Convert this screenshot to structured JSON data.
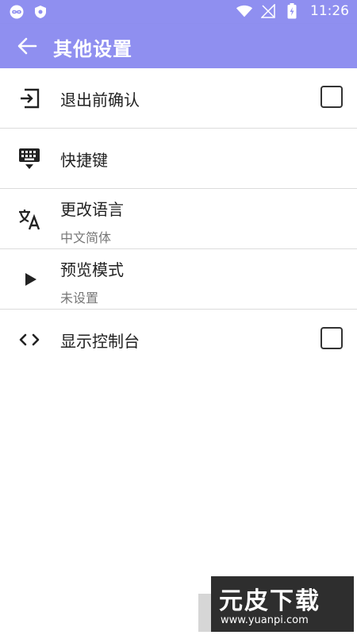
{
  "status_bar": {
    "time": "11:26",
    "icons": [
      "infinity-icon",
      "shield-icon",
      "wifi-icon",
      "signal-icon",
      "battery-charging-icon"
    ]
  },
  "app_bar": {
    "title": "其他设置"
  },
  "settings": [
    {
      "icon": "exit-icon",
      "label": "退出前确认",
      "checkbox": true
    },
    {
      "icon": "keyboard-icon",
      "label": "快捷键"
    },
    {
      "icon": "translate-icon",
      "label": "更改语言",
      "subtitle": "中文简体"
    },
    {
      "icon": "play-icon",
      "label": "预览模式",
      "subtitle": "未设置"
    },
    {
      "icon": "code-icon",
      "label": "显示控制台",
      "checkbox": true
    }
  ],
  "colors": {
    "accent": "#8f8ff0",
    "checkbox_fill": "#3399ee",
    "divider": "#dcdcdc"
  },
  "watermark": {
    "brand": "元皮下载",
    "url": "www.yuanpi.com"
  }
}
